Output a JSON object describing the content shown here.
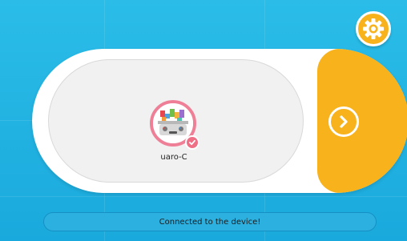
{
  "device": {
    "name": "uaro-C",
    "connected": true
  },
  "status": {
    "message": "Connected to the device!"
  },
  "icons": {
    "settings": "gear-icon",
    "next": "chevron-right-icon",
    "check": "check-icon"
  },
  "colors": {
    "background": "#1aa9dc",
    "accent": "#f7b21c",
    "selected": "#ef7f96"
  }
}
